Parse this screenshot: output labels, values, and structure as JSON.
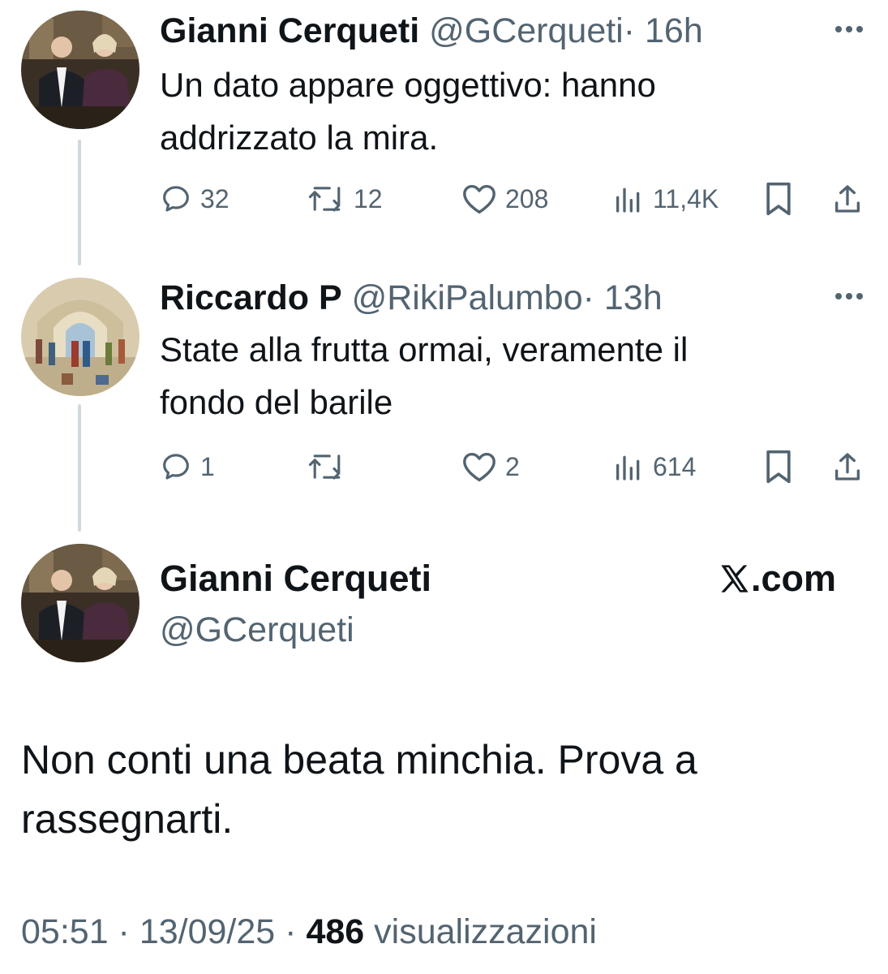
{
  "colors": {
    "text": "#0f1419",
    "muted": "#536471",
    "thread_line": "#cfd9de"
  },
  "thread": [
    {
      "name": "Gianni Cerqueti",
      "handle": "@GCerqueti",
      "time": "· 16h",
      "avatar_icon": "profile-photo-two-people",
      "text_lines": [
        "Un dato appare oggettivo: hanno",
        "addrizzato la mira."
      ],
      "replies": "32",
      "retweets": "12",
      "likes": "208",
      "views": "11,4K"
    },
    {
      "name": "Riccardo P",
      "handle": "@RikiPalumbo",
      "time": "· 13h",
      "avatar_icon": "profile-painting-school-of-athens",
      "text_lines": [
        "State alla frutta ormai, veramente il",
        "fondo del barile"
      ],
      "replies": "1",
      "retweets": "",
      "likes": "2",
      "views": "614"
    }
  ],
  "main": {
    "name": "Gianni Cerqueti",
    "handle": "@GCerqueti",
    "brand": ".com",
    "brand_icon": "x-logo-icon",
    "text_lines": [
      "Non conti una beata minchia. Prova a",
      "rassegnarti."
    ],
    "time": "05:51",
    "date": "13/09/25",
    "views_count": "486",
    "views_label": "visualizzazioni"
  }
}
